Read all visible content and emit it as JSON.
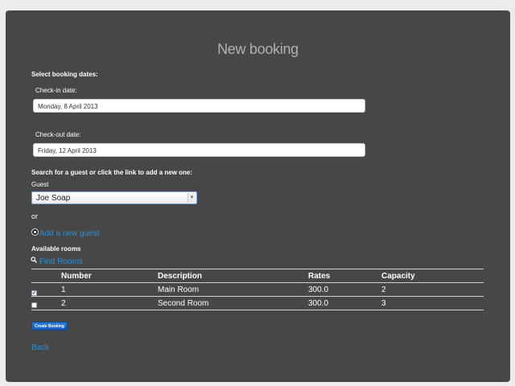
{
  "page": {
    "title": "New booking"
  },
  "dates": {
    "section_label": "Select booking dates:",
    "checkin_label": "Check-in date:",
    "checkin_value": "Monday, 8 April 2013",
    "checkout_label": "Check-out date:",
    "checkout_value": "Friday, 12 April 2013"
  },
  "guest": {
    "section_label": "Search for a guest or click the link to add a new one:",
    "field_label": "Guest",
    "selected_value": "Joe Soap",
    "or_text": "or",
    "add_link": "Add a new guest"
  },
  "rooms": {
    "section_label": "Available rooms",
    "find_link": "Find Rooms",
    "headers": [
      "Number",
      "Description",
      "Rates",
      "Capacity"
    ],
    "rows": [
      {
        "checked": true,
        "number": "1",
        "description": "Main Room",
        "rate": "300.0",
        "capacity": "2"
      },
      {
        "checked": false,
        "number": "2",
        "description": "Second Room",
        "rate": "300.0",
        "capacity": "3"
      }
    ]
  },
  "actions": {
    "create_label": "Create Booking",
    "back_label": "Back"
  },
  "colors": {
    "panel_bg": "#474747",
    "page_bg": "#ececec",
    "link": "#2a8fd8",
    "button": "#1a6ad0"
  },
  "icons": {
    "radio": "radio-dot-icon",
    "search": "magnifier-icon",
    "dropdown": "chevron-down-icon",
    "check": "checkmark-icon"
  }
}
